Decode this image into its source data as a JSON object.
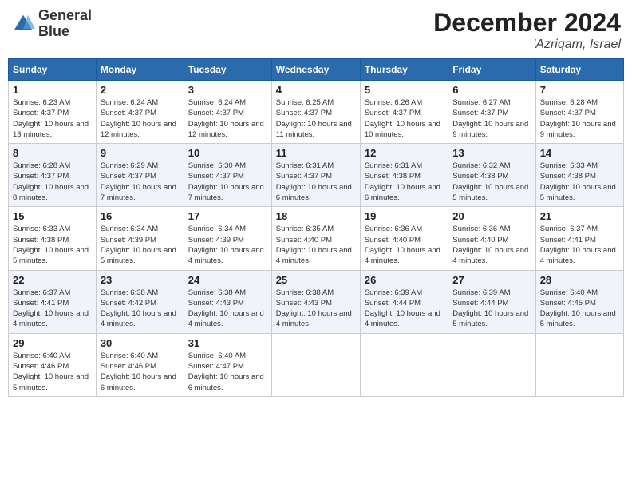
{
  "header": {
    "logo_line1": "General",
    "logo_line2": "Blue",
    "month_title": "December 2024",
    "location": "'Azriqam, Israel"
  },
  "days_of_week": [
    "Sunday",
    "Monday",
    "Tuesday",
    "Wednesday",
    "Thursday",
    "Friday",
    "Saturday"
  ],
  "weeks": [
    [
      {
        "day": "1",
        "sunrise": "6:23 AM",
        "sunset": "4:37 PM",
        "daylight": "10 hours and 13 minutes."
      },
      {
        "day": "2",
        "sunrise": "6:24 AM",
        "sunset": "4:37 PM",
        "daylight": "10 hours and 12 minutes."
      },
      {
        "day": "3",
        "sunrise": "6:24 AM",
        "sunset": "4:37 PM",
        "daylight": "10 hours and 12 minutes."
      },
      {
        "day": "4",
        "sunrise": "6:25 AM",
        "sunset": "4:37 PM",
        "daylight": "10 hours and 11 minutes."
      },
      {
        "day": "5",
        "sunrise": "6:26 AM",
        "sunset": "4:37 PM",
        "daylight": "10 hours and 10 minutes."
      },
      {
        "day": "6",
        "sunrise": "6:27 AM",
        "sunset": "4:37 PM",
        "daylight": "10 hours and 9 minutes."
      },
      {
        "day": "7",
        "sunrise": "6:28 AM",
        "sunset": "4:37 PM",
        "daylight": "10 hours and 9 minutes."
      }
    ],
    [
      {
        "day": "8",
        "sunrise": "6:28 AM",
        "sunset": "4:37 PM",
        "daylight": "10 hours and 8 minutes."
      },
      {
        "day": "9",
        "sunrise": "6:29 AM",
        "sunset": "4:37 PM",
        "daylight": "10 hours and 7 minutes."
      },
      {
        "day": "10",
        "sunrise": "6:30 AM",
        "sunset": "4:37 PM",
        "daylight": "10 hours and 7 minutes."
      },
      {
        "day": "11",
        "sunrise": "6:31 AM",
        "sunset": "4:37 PM",
        "daylight": "10 hours and 6 minutes."
      },
      {
        "day": "12",
        "sunrise": "6:31 AM",
        "sunset": "4:38 PM",
        "daylight": "10 hours and 6 minutes."
      },
      {
        "day": "13",
        "sunrise": "6:32 AM",
        "sunset": "4:38 PM",
        "daylight": "10 hours and 5 minutes."
      },
      {
        "day": "14",
        "sunrise": "6:33 AM",
        "sunset": "4:38 PM",
        "daylight": "10 hours and 5 minutes."
      }
    ],
    [
      {
        "day": "15",
        "sunrise": "6:33 AM",
        "sunset": "4:38 PM",
        "daylight": "10 hours and 5 minutes."
      },
      {
        "day": "16",
        "sunrise": "6:34 AM",
        "sunset": "4:39 PM",
        "daylight": "10 hours and 5 minutes."
      },
      {
        "day": "17",
        "sunrise": "6:34 AM",
        "sunset": "4:39 PM",
        "daylight": "10 hours and 4 minutes."
      },
      {
        "day": "18",
        "sunrise": "6:35 AM",
        "sunset": "4:40 PM",
        "daylight": "10 hours and 4 minutes."
      },
      {
        "day": "19",
        "sunrise": "6:36 AM",
        "sunset": "4:40 PM",
        "daylight": "10 hours and 4 minutes."
      },
      {
        "day": "20",
        "sunrise": "6:36 AM",
        "sunset": "4:40 PM",
        "daylight": "10 hours and 4 minutes."
      },
      {
        "day": "21",
        "sunrise": "6:37 AM",
        "sunset": "4:41 PM",
        "daylight": "10 hours and 4 minutes."
      }
    ],
    [
      {
        "day": "22",
        "sunrise": "6:37 AM",
        "sunset": "4:41 PM",
        "daylight": "10 hours and 4 minutes."
      },
      {
        "day": "23",
        "sunrise": "6:38 AM",
        "sunset": "4:42 PM",
        "daylight": "10 hours and 4 minutes."
      },
      {
        "day": "24",
        "sunrise": "6:38 AM",
        "sunset": "4:43 PM",
        "daylight": "10 hours and 4 minutes."
      },
      {
        "day": "25",
        "sunrise": "6:38 AM",
        "sunset": "4:43 PM",
        "daylight": "10 hours and 4 minutes."
      },
      {
        "day": "26",
        "sunrise": "6:39 AM",
        "sunset": "4:44 PM",
        "daylight": "10 hours and 4 minutes."
      },
      {
        "day": "27",
        "sunrise": "6:39 AM",
        "sunset": "4:44 PM",
        "daylight": "10 hours and 5 minutes."
      },
      {
        "day": "28",
        "sunrise": "6:40 AM",
        "sunset": "4:45 PM",
        "daylight": "10 hours and 5 minutes."
      }
    ],
    [
      {
        "day": "29",
        "sunrise": "6:40 AM",
        "sunset": "4:46 PM",
        "daylight": "10 hours and 5 minutes."
      },
      {
        "day": "30",
        "sunrise": "6:40 AM",
        "sunset": "4:46 PM",
        "daylight": "10 hours and 6 minutes."
      },
      {
        "day": "31",
        "sunrise": "6:40 AM",
        "sunset": "4:47 PM",
        "daylight": "10 hours and 6 minutes."
      },
      null,
      null,
      null,
      null
    ]
  ]
}
